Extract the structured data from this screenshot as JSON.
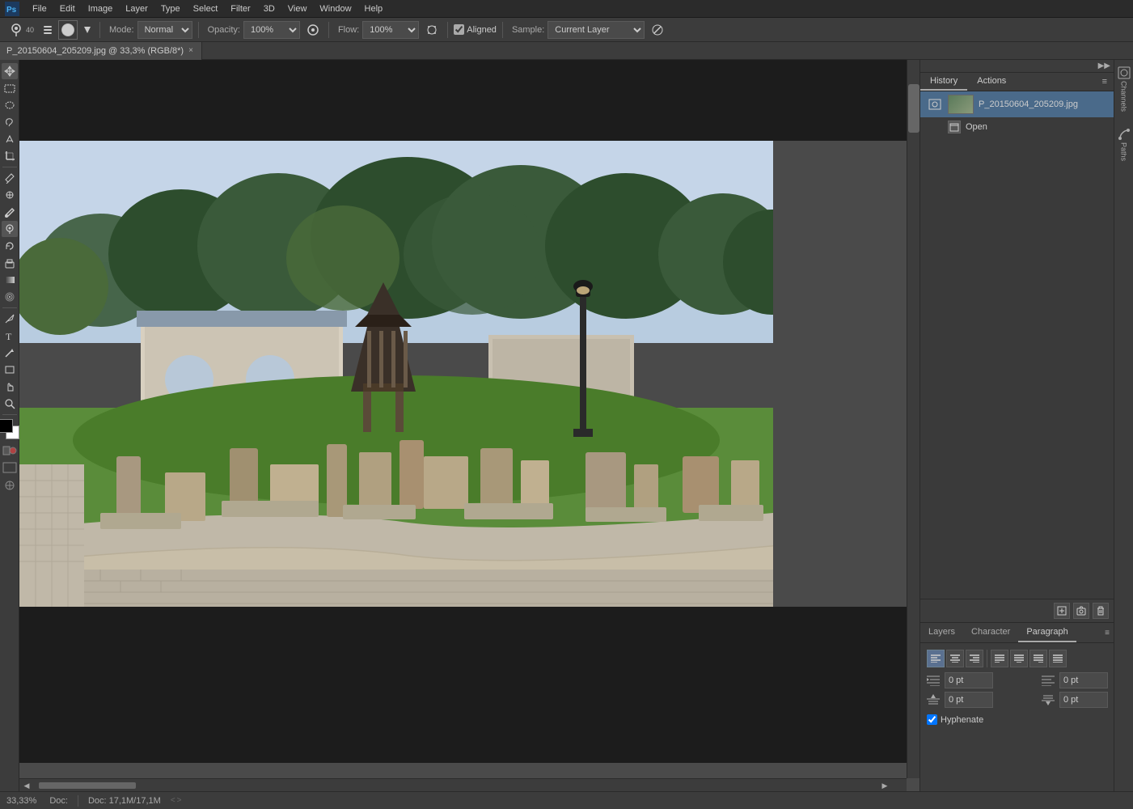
{
  "app": {
    "title": "Adobe Photoshop",
    "logo": "Ps"
  },
  "menubar": {
    "items": [
      "File",
      "Edit",
      "Image",
      "Layer",
      "Type",
      "Select",
      "Filter",
      "3D",
      "View",
      "Window",
      "Help"
    ]
  },
  "toolbar": {
    "brush_size": "40",
    "mode_label": "Mode:",
    "mode_value": "Normal",
    "opacity_label": "Opacity:",
    "opacity_value": "100%",
    "flow_label": "Flow:",
    "flow_value": "100%",
    "aligned_label": "Aligned",
    "aligned_checked": true,
    "sample_label": "Sample:",
    "sample_value": "Current Layer"
  },
  "tab": {
    "filename": "P_20150604_205209.jpg @ 33,3% (RGB/8*)",
    "close_icon": "×"
  },
  "canvas": {
    "zoom": "33,33%",
    "doc_info": "Doc: 17,1M/17,1M"
  },
  "history": {
    "tab_label": "History",
    "actions_label": "Actions",
    "snapshot_filename": "P_20150604_205209.jpg",
    "open_label": "Open",
    "menu_icon": "≡"
  },
  "right_icons": {
    "channels_label": "Channels",
    "paths_label": "Paths"
  },
  "bottom_panel": {
    "layers_tab": "Layers",
    "character_tab": "Character",
    "paragraph_tab": "Paragraph",
    "menu_icon": "≡"
  },
  "paragraph": {
    "alignments": [
      {
        "id": "align-left",
        "icon": "≡",
        "active": true,
        "title": "Align left"
      },
      {
        "id": "align-center",
        "icon": "≡",
        "active": false,
        "title": "Align center"
      },
      {
        "id": "align-right",
        "icon": "≡",
        "active": false,
        "title": "Align right"
      },
      {
        "id": "justify-left",
        "icon": "≡",
        "active": false,
        "title": "Justify with last left"
      },
      {
        "id": "justify-center",
        "icon": "≡",
        "active": false,
        "title": "Justify with last center"
      },
      {
        "id": "justify-right",
        "icon": "≡",
        "active": false,
        "title": "Justify with last right"
      },
      {
        "id": "justify-all",
        "icon": "≡",
        "active": false,
        "title": "Justify all"
      }
    ],
    "indent_left_label": "Indent left margin",
    "indent_left_value": "0 pt",
    "indent_right_label": "Indent right margin",
    "indent_right_value": "0 pt",
    "add_before_label": "Add space before paragraph",
    "add_before_value": "0 pt",
    "add_after_label": "Add space after paragraph",
    "add_after_value": "0 pt",
    "hyphenate_label": "Hyphenate",
    "hyphenate_checked": true
  },
  "panel_icons": {
    "new_icon": "🗋",
    "camera_icon": "📷",
    "delete_icon": "🗑"
  },
  "status": {
    "zoom": "33,33%",
    "doc_info": "Doc: 17,1M/17,1M",
    "nav_left": "<",
    "nav_right": ">"
  },
  "tools": {
    "list": [
      {
        "id": "move",
        "icon": "✛",
        "active": false
      },
      {
        "id": "marquee-rect",
        "icon": "⬚",
        "active": false
      },
      {
        "id": "marquee-ellipse",
        "icon": "◯",
        "active": false
      },
      {
        "id": "lasso",
        "icon": "⌾",
        "active": false
      },
      {
        "id": "magic-wand",
        "icon": "✦",
        "active": false
      },
      {
        "id": "crop",
        "icon": "⧠",
        "active": false
      },
      {
        "id": "eyedropper",
        "icon": "⊕",
        "active": false
      },
      {
        "id": "healing-brush",
        "icon": "✿",
        "active": false
      },
      {
        "id": "brush",
        "icon": "✏",
        "active": false
      },
      {
        "id": "clone-stamp",
        "icon": "✐",
        "active": true
      },
      {
        "id": "history-brush",
        "icon": "↺",
        "active": false
      },
      {
        "id": "eraser",
        "icon": "◻",
        "active": false
      },
      {
        "id": "gradient",
        "icon": "▦",
        "active": false
      },
      {
        "id": "blur",
        "icon": "◈",
        "active": false
      },
      {
        "id": "dodge",
        "icon": "◑",
        "active": false
      },
      {
        "id": "pen",
        "icon": "✒",
        "active": false
      },
      {
        "id": "type",
        "icon": "T",
        "active": false
      },
      {
        "id": "path-select",
        "icon": "↗",
        "active": false
      },
      {
        "id": "rectangle",
        "icon": "▭",
        "active": false
      },
      {
        "id": "hand",
        "icon": "☞",
        "active": false
      },
      {
        "id": "zoom",
        "icon": "⌕",
        "active": false
      }
    ]
  }
}
